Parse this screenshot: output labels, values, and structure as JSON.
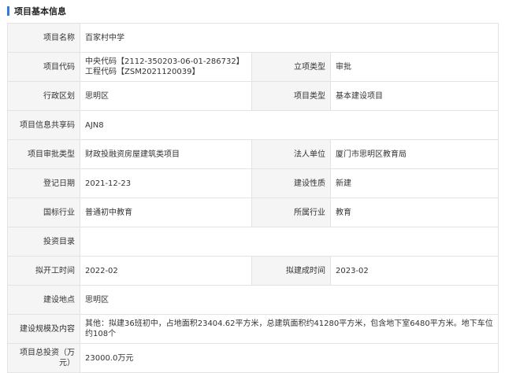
{
  "section": {
    "title": "项目基本信息"
  },
  "fields": {
    "project_name": {
      "label": "项目名称",
      "value": "百家村中学"
    },
    "project_code": {
      "label": "项目代码",
      "value_line1": "中央代码【2112-350203-06-01-286732】",
      "value_line2": "工程代码【ZSM2021120039】"
    },
    "approval_type": {
      "label": "立项类型",
      "value": "审批"
    },
    "district": {
      "label": "行政区划",
      "value": "思明区"
    },
    "project_type": {
      "label": "项目类型",
      "value": "基本建设项目"
    },
    "share_code": {
      "label": "项目信息共享码",
      "value": "AJN8"
    },
    "review_type": {
      "label": "项目审批类型",
      "value": "财政投融资房屋建筑类项目"
    },
    "legal_unit": {
      "label": "法人单位",
      "value": "厦门市思明区教育局"
    },
    "register_date": {
      "label": "登记日期",
      "value": "2021-12-23"
    },
    "construction_nature": {
      "label": "建设性质",
      "value": "新建"
    },
    "national_industry": {
      "label": "国标行业",
      "value": "普通初中教育"
    },
    "industry": {
      "label": "所属行业",
      "value": "教育"
    },
    "investment_catalog": {
      "label": "投资目录",
      "value": ""
    },
    "planned_start": {
      "label": "拟开工时间",
      "value": "2022-02"
    },
    "planned_completion": {
      "label": "拟建成时间",
      "value": "2023-02"
    },
    "site": {
      "label": "建设地点",
      "value": "思明区"
    },
    "scale": {
      "label": "建设规模及内容",
      "value": "其他：拟建36班初中，占地面积23404.62平方米，总建筑面积约41280平方米，包含地下室6480平方米。地下车位约108个"
    },
    "total_investment": {
      "label_line1": "项目总投资（万",
      "label_line2": "元）",
      "value": "23000.0万元"
    }
  }
}
